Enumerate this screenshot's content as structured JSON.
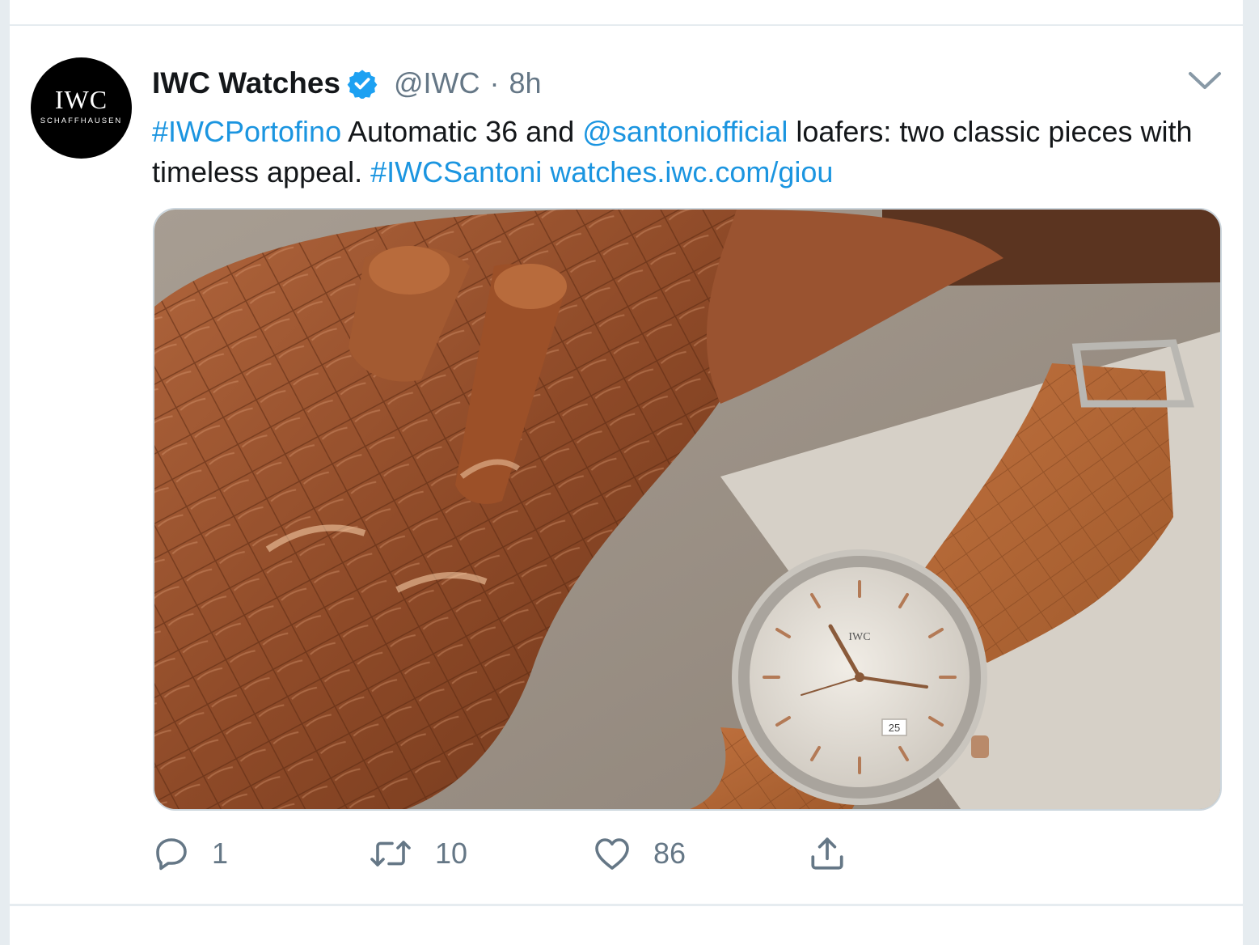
{
  "tweet": {
    "avatar": {
      "logo_main": "IWC",
      "logo_sub": "SCHAFFHAUSEN"
    },
    "display_name": "IWC Watches",
    "verified": true,
    "handle": "@IWC",
    "separator": "·",
    "time": "8h",
    "text": {
      "hashtag1": "#IWCPortofino",
      "part1": " Automatic 36 and ",
      "mention": "@santoniofficial",
      "part2": " loafers: two classic pieces with timeless appeal. ",
      "hashtag2": "#IWCSantoni",
      "space": " ",
      "url": "watches.iwc.com/giou"
    },
    "media": {
      "watch_date": "25",
      "watch_brand": "IWC"
    },
    "actions": {
      "reply_count": "1",
      "retweet_count": "10",
      "like_count": "86"
    }
  },
  "icons": {
    "verified": "verified-badge-icon",
    "caret": "chevron-down-icon",
    "reply": "reply-icon",
    "retweet": "retweet-icon",
    "like": "heart-icon",
    "share": "share-icon"
  },
  "colors": {
    "link": "#1b95e0",
    "text": "#14171a",
    "secondary": "#657786",
    "verified": "#1da1f2",
    "border": "#e6ecf0"
  }
}
